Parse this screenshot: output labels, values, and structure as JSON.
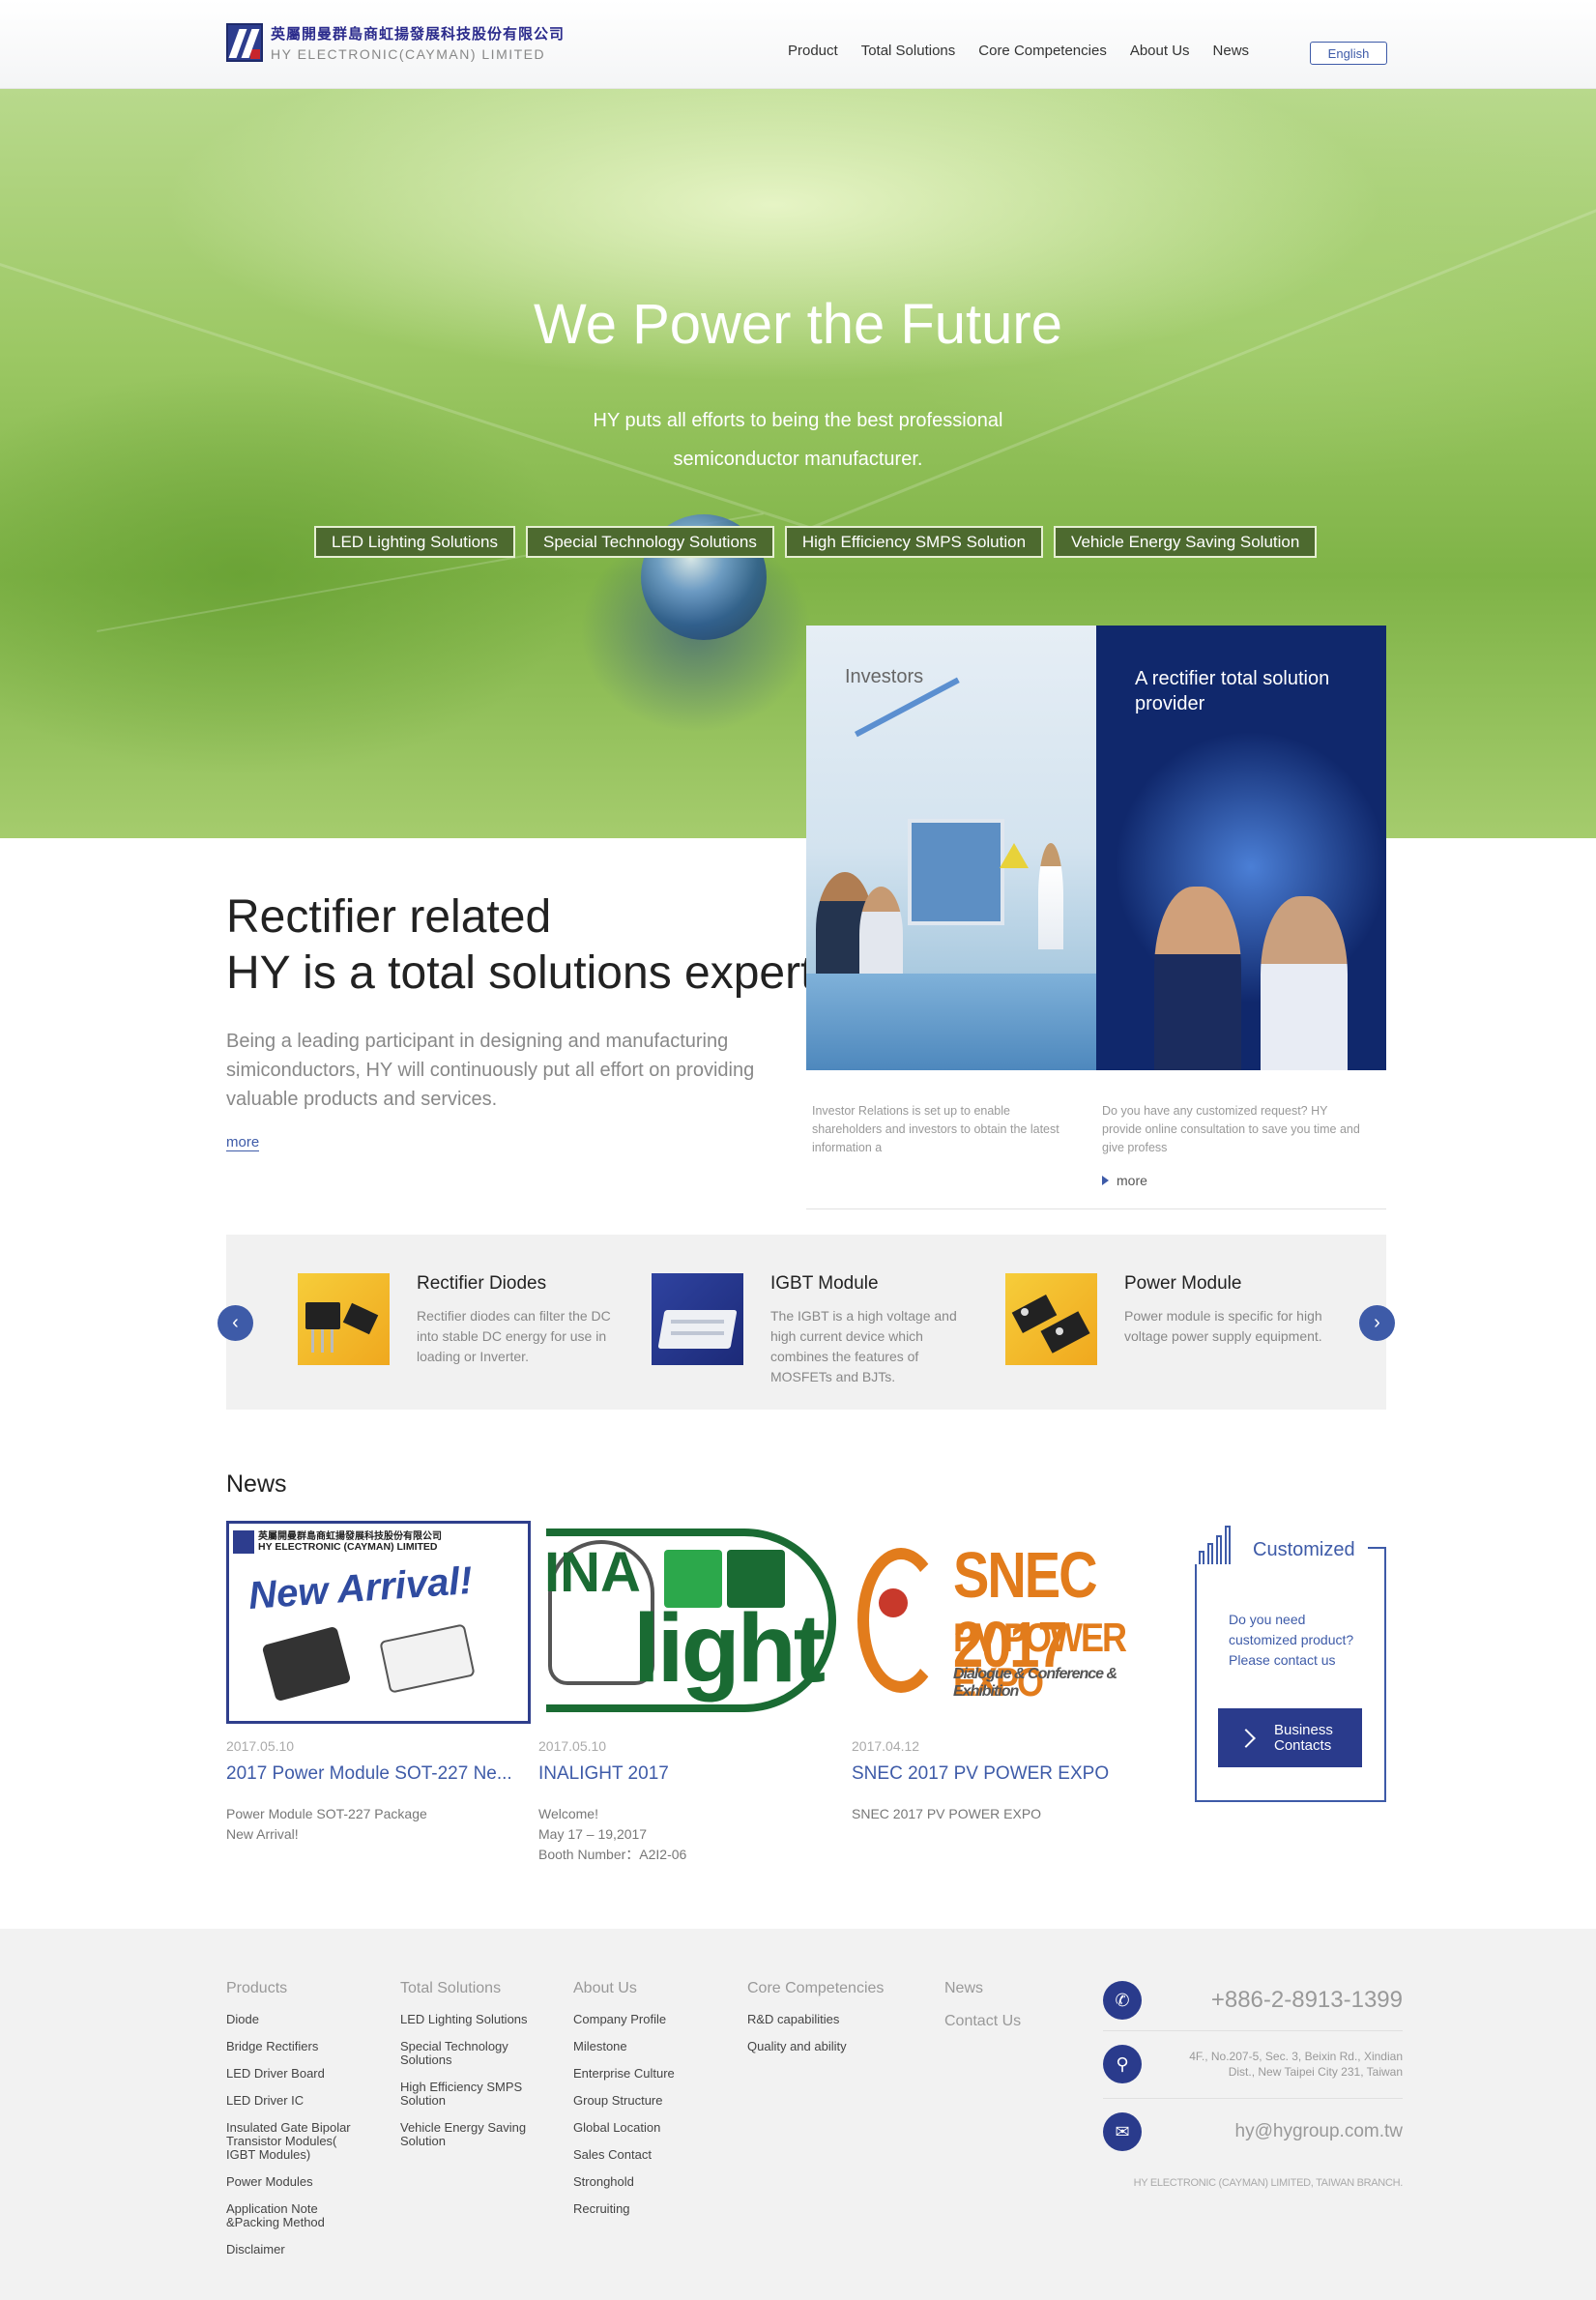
{
  "header": {
    "logo_cn": "英屬開曼群島商虹揚發展科技股份有限公司",
    "logo_en": "HY ELECTRONIC(CAYMAN) LIMITED",
    "nav": [
      "Product",
      "Total Solutions",
      "Core Competencies",
      "About Us",
      "News"
    ],
    "lang": "English"
  },
  "hero": {
    "title": "We Power the Future",
    "subtitle_line1": "HY puts all efforts to being the best professional",
    "subtitle_line2": "semiconductor manufacturer.",
    "buttons": [
      "LED Lighting Solutions",
      "Special Technology Solutions",
      "High Efficiency SMPS Solution",
      "Vehicle Energy Saving Solution"
    ]
  },
  "intro": {
    "title_line1": "Rectifier related",
    "title_line2": "HY is a total solutions expert",
    "desc": "Being a leading participant in designing and manufacturing simiconductors, HY will continuously put all effort on providing valuable products and services.",
    "more": "more"
  },
  "cards": {
    "investors_label": "Investors",
    "provider_label": "A rectifier total solution provider",
    "investors_text": "Investor Relations is set up to enable shareholders and investors to obtain the latest information a",
    "provider_text": "Do you have any customized request? HY provide online consultation to save you time and give profess",
    "more": "more"
  },
  "products": [
    {
      "title": "Rectifier Diodes",
      "desc": "Rectifier diodes can filter the DC into stable DC energy for use in loading or Inverter."
    },
    {
      "title": "IGBT Module",
      "desc": "The IGBT is a high voltage and high current device which combines the features of MOSFETs and BJTs."
    },
    {
      "title": "Power Module",
      "desc": "Power module is specific for high voltage power supply equipment."
    }
  ],
  "news": {
    "heading": "News",
    "items": [
      {
        "date": "2017.05.10",
        "title": "2017 Power Module SOT-227 Ne...",
        "desc_lines": [
          "Power Module SOT-227 Package",
          "New Arrival!"
        ],
        "img_cn": "英屬開曼群島商虹揚發展科技股份有限公司",
        "img_en": "HY ELECTRONIC (CAYMAN) LIMITED",
        "img_text": "New Arrival!"
      },
      {
        "date": "2017.05.10",
        "title": "INALIGHT 2017",
        "desc_lines": [
          "Welcome!",
          "May 17 – 19,2017",
          "Booth Number：A2I2-06"
        ],
        "img_text_1": "INA",
        "img_text_2": "light"
      },
      {
        "date": "2017.04.12",
        "title": "SNEC 2017 PV POWER EXPO",
        "desc_lines": [
          "SNEC 2017 PV POWER EXPO"
        ],
        "img_text_1": "SNEC 2017",
        "img_text_2": "PV POWER EXPO",
        "img_text_3": "Dialogue & Conference & Exhibition"
      }
    ]
  },
  "customized": {
    "title": "Customized",
    "text": "Do you need customized product? Please contact us",
    "button_line1": "Business",
    "button_line2": "Contacts"
  },
  "footer": {
    "products": {
      "title": "Products",
      "items": [
        "Diode",
        "Bridge Rectifiers",
        "LED Driver Board",
        "LED Driver IC",
        "Insulated Gate Bipolar Transistor Modules( IGBT Modules)",
        "Power Modules",
        "Application Note &Packing Method",
        "Disclaimer"
      ]
    },
    "solutions": {
      "title": "Total Solutions",
      "items": [
        "LED Lighting Solutions",
        "Special Technology Solutions",
        "High Efficiency SMPS Solution",
        "Vehicle Energy Saving Solution"
      ]
    },
    "about": {
      "title": "About Us",
      "items": [
        "Company Profile",
        "Milestone",
        "Enterprise Culture",
        "Group Structure",
        "Global Location",
        "Sales Contact",
        "Stronghold",
        "Recruiting"
      ]
    },
    "core": {
      "title": "Core Competencies",
      "items": [
        "R&D capabilities",
        "Quality and ability"
      ]
    },
    "news": {
      "title": "News",
      "contact": "Contact Us"
    },
    "phone": "+886-2-8913-1399",
    "address": "4F., No.207-5, Sec. 3, Beixin Rd., Xindian Dist., New Taipei City 231, Taiwan",
    "email": "hy@hygroup.com.tw",
    "copyright": "HY ELECTRONIC (CAYMAN) LIMITED, TAIWAN BRANCH."
  },
  "colors": {
    "accent": "#3e5ba8",
    "dark_blue": "#2a3b8c",
    "hero_green": "#9cc864"
  }
}
